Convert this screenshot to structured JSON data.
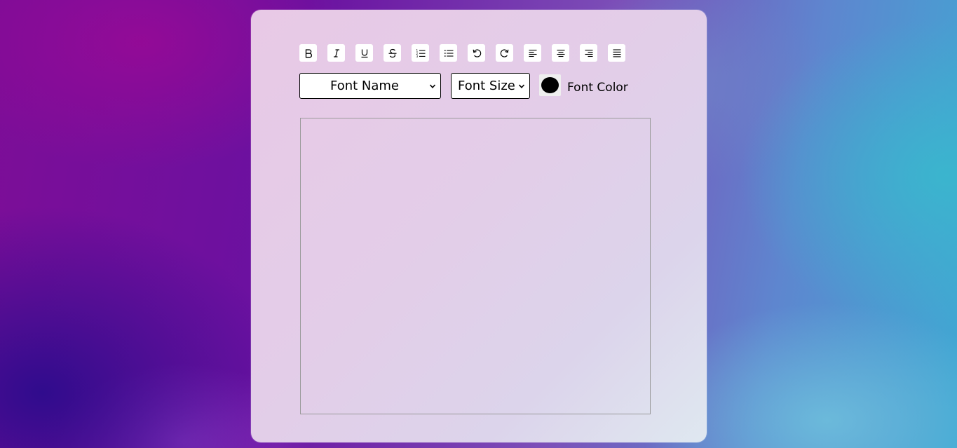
{
  "toolbar": {
    "buttons": [
      {
        "name": "bold",
        "icon": "bold-icon"
      },
      {
        "name": "italic",
        "icon": "italic-icon"
      },
      {
        "name": "underline",
        "icon": "underline-icon"
      },
      {
        "name": "strikethrough",
        "icon": "strikethrough-icon"
      },
      {
        "name": "ordered-list",
        "icon": "ordered-list-icon"
      },
      {
        "name": "unordered-list",
        "icon": "unordered-list-icon"
      },
      {
        "name": "undo",
        "icon": "undo-icon"
      },
      {
        "name": "redo",
        "icon": "redo-icon"
      },
      {
        "name": "align-left",
        "icon": "align-left-icon"
      },
      {
        "name": "align-center",
        "icon": "align-center-icon"
      },
      {
        "name": "align-right",
        "icon": "align-right-icon"
      },
      {
        "name": "justify",
        "icon": "justify-icon"
      }
    ]
  },
  "controls": {
    "font_name": {
      "selected": "Font Name"
    },
    "font_size": {
      "selected": "Font Size"
    },
    "font_color": {
      "label": "Font Color",
      "value": "#000000"
    }
  },
  "editor": {
    "content": ""
  },
  "colors": {
    "card_background": "#e5cde8",
    "button_background": "#ffffff",
    "editor_border": "#9a9a9a"
  }
}
